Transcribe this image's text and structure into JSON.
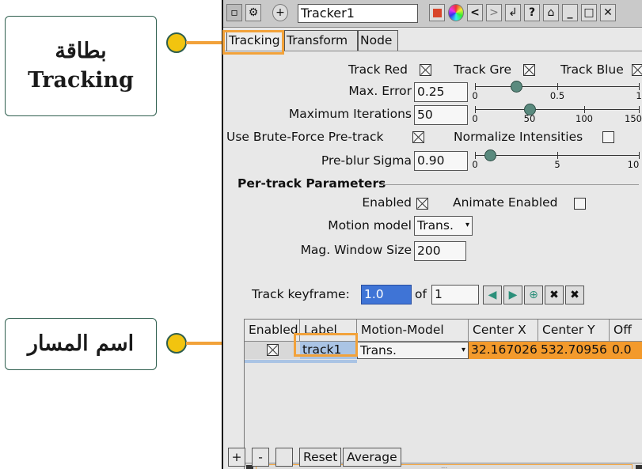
{
  "callouts": {
    "tracking_tab_line1": "بطاقة",
    "tracking_tab_line2": "Tracking",
    "track_name": "اسم المسار"
  },
  "window": {
    "title": "Tracker1",
    "icons": [
      "stop-icon",
      "color-wheel-icon",
      "prev-icon",
      "next-icon",
      "reset-icon",
      "help-icon",
      "settings-icon",
      "minimize-icon",
      "maximize-icon",
      "close-icon"
    ]
  },
  "tabs": [
    "Tracking",
    "Transform",
    "Node"
  ],
  "tracking": {
    "track_red": "Track Red",
    "track_green": "Track Gre",
    "track_blue": "Track Blue",
    "max_error_label": "Max. Error",
    "max_error_value": "0.25",
    "max_error_ticks": [
      "0",
      "0.5",
      "1"
    ],
    "max_error_level": 0.25,
    "max_iter_label": "Maximum Iterations",
    "max_iter_value": "50",
    "max_iter_ticks": [
      "0",
      "50",
      "100",
      "150"
    ],
    "max_iter_level": 50,
    "brute_force_label": "Use Brute-Force Pre-track",
    "normalize_label": "Normalize Intensities",
    "preblur_label": "Pre-blur Sigma",
    "preblur_value": "0.90",
    "preblur_ticks": [
      "0",
      "5",
      "10"
    ],
    "preblur_level": 0.9
  },
  "per_track": {
    "heading": "Per-track Parameters",
    "enabled_label": "Enabled",
    "animate_label": "Animate Enabled",
    "motion_model_label": "Motion model",
    "motion_model_value": "Trans.",
    "mag_window_label": "Mag. Window Size",
    "mag_window_value": "200",
    "keyframe_label": "Track keyframe:",
    "keyframe_value": "1.0",
    "keyframe_of": "of",
    "keyframe_total": "1"
  },
  "table": {
    "headers": [
      "Enabled",
      "Label",
      "Motion-Model",
      "Center X",
      "Center Y",
      "Off"
    ],
    "rows": [
      {
        "label": "track1",
        "motion_model": "Trans.",
        "center_x": "32.167026",
        "center_y": "532.70956",
        "offset": "0.0"
      }
    ],
    "scroll_grip": ":::"
  },
  "bottom_buttons": [
    "+",
    "-",
    "",
    "Reset",
    "Average"
  ]
}
